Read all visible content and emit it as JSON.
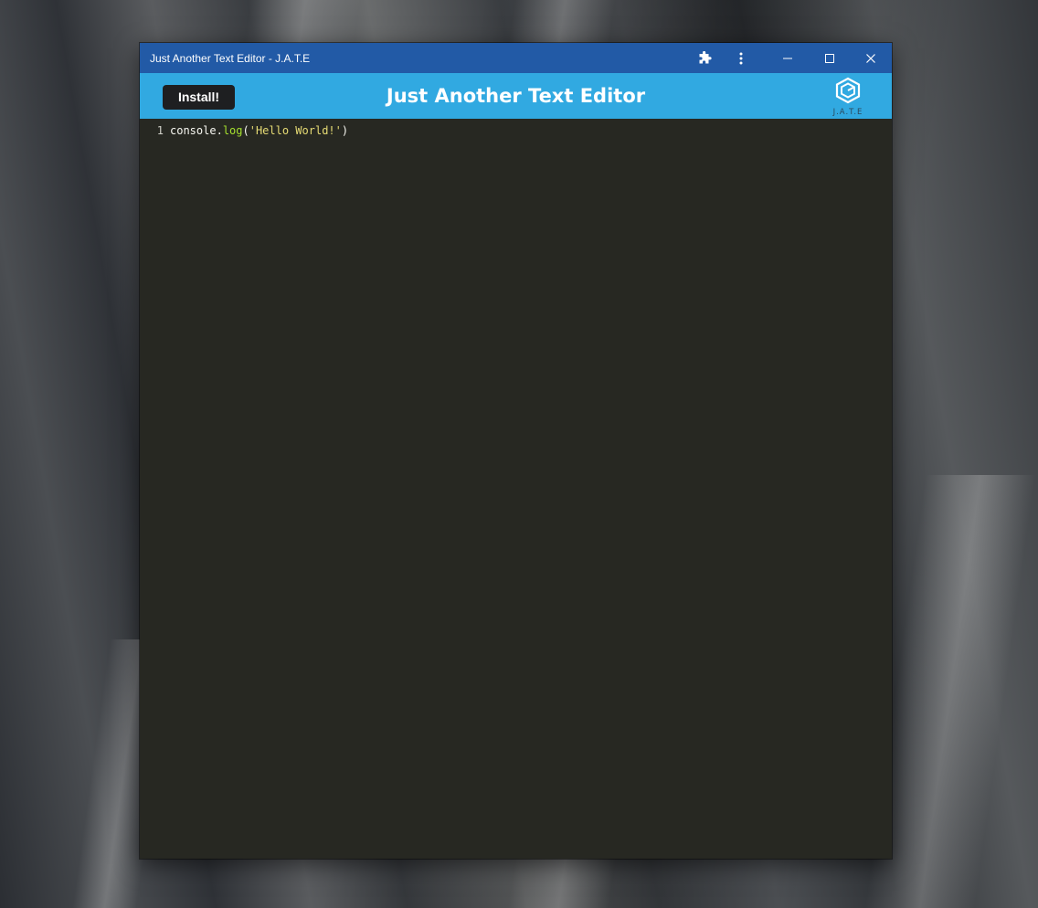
{
  "window": {
    "title": "Just Another Text Editor - J.A.T.E"
  },
  "titlebar_icons": [
    "puzzle-extension-icon",
    "more-vertical-icon",
    "minimize-icon",
    "maximize-icon",
    "close-icon"
  ],
  "header": {
    "install_label": "Install!",
    "title": "Just Another Text Editor",
    "logo_text": "J.A.T.E"
  },
  "editor": {
    "lines": [
      {
        "number": "1",
        "tokens": {
          "object": "console",
          "dot": ".",
          "method": "log",
          "open": "(",
          "string": "'Hello World!'",
          "close": ")"
        }
      }
    ]
  },
  "colors": {
    "titlebar": "#225aa6",
    "header": "#31a9e1",
    "install_button": "#1e1f21",
    "editor_bg": "#272822",
    "code_plain": "#f8f8f2",
    "code_function": "#a6e22e",
    "code_string": "#e6db74"
  }
}
